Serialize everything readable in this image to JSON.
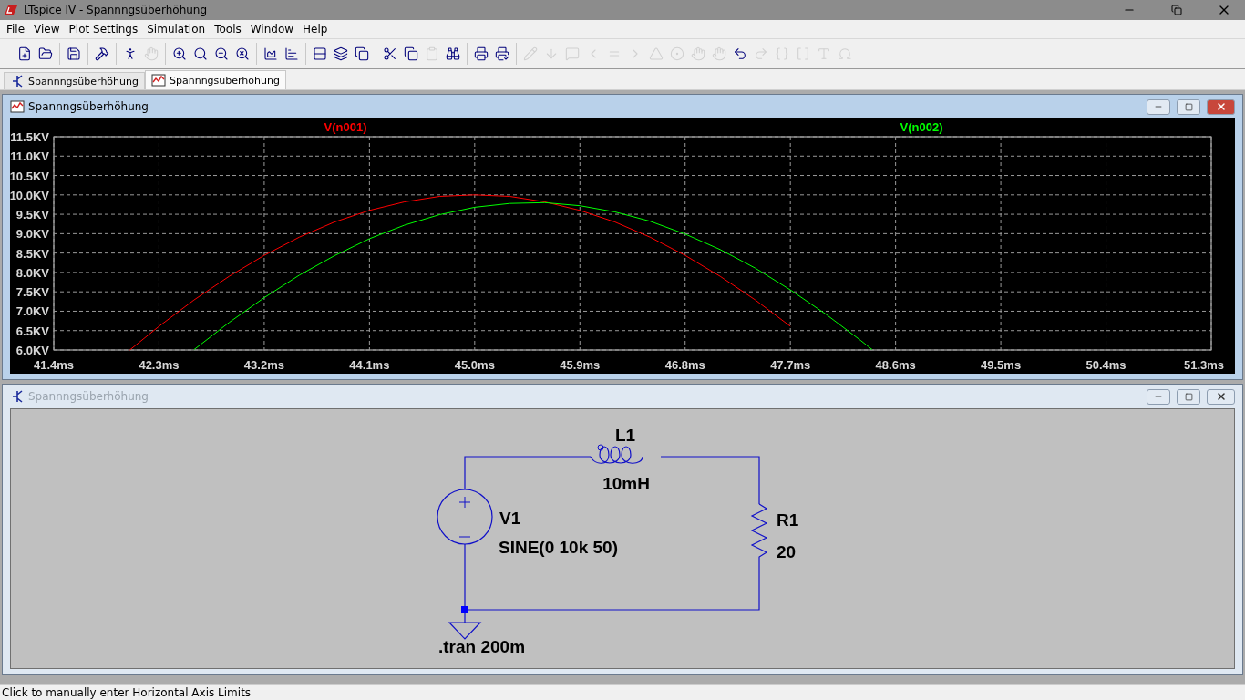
{
  "window": {
    "title": "LTspice IV - Spannngsüberhöhung"
  },
  "menu": [
    "File",
    "View",
    "Plot Settings",
    "Simulation",
    "Tools",
    "Window",
    "Help"
  ],
  "toolbar": [
    {
      "disabled": false
    },
    {
      "disabled": false
    },
    {
      "disabled": false
    },
    {
      "disabled": false
    },
    {
      "disabled": false
    },
    {
      "disabled": true
    },
    {
      "disabled": false
    },
    {
      "disabled": false
    },
    {
      "disabled": false
    },
    {
      "disabled": false
    },
    {
      "disabled": false
    },
    {
      "disabled": false
    },
    {
      "disabled": false
    },
    {
      "disabled": false
    },
    {
      "disabled": false
    },
    {
      "disabled": false
    },
    {
      "disabled": false
    },
    {
      "disabled": true
    },
    {
      "disabled": false
    },
    {
      "disabled": false
    },
    {
      "disabled": false
    },
    {
      "disabled": true
    },
    {
      "disabled": true
    },
    {
      "disabled": true
    },
    {
      "disabled": true
    },
    {
      "disabled": true
    },
    {
      "disabled": true
    },
    {
      "disabled": true
    },
    {
      "disabled": true
    },
    {
      "disabled": true
    },
    {
      "disabled": true
    },
    {
      "disabled": false
    },
    {
      "disabled": true
    },
    {
      "disabled": true
    },
    {
      "disabled": true
    },
    {
      "disabled": true
    },
    {
      "disabled": true
    }
  ],
  "tabs": [
    {
      "label": "Spannngsüberhöhung",
      "kind": "schematic",
      "selected": false
    },
    {
      "label": "Spannngsüberhöhung",
      "kind": "plot",
      "selected": true
    }
  ],
  "plot_window": {
    "title": "Spannngsüberhöhung",
    "active": true,
    "chart_data": {
      "type": "line",
      "x": [
        42.05,
        42.3,
        42.6,
        42.9,
        43.2,
        43.5,
        43.8,
        44.1,
        44.4,
        44.7,
        45.0,
        45.3,
        45.6,
        45.9,
        46.2,
        46.5,
        46.8,
        47.1,
        47.4,
        47.7,
        48.0,
        48.3,
        48.4
      ],
      "series": [
        {
          "name": "V(n001)",
          "color": "#ff0000",
          "values": [
            6.0,
            6.61,
            7.29,
            7.9,
            8.44,
            8.91,
            9.3,
            9.6,
            9.82,
            9.96,
            10.0,
            9.96,
            9.82,
            9.6,
            9.3,
            8.91,
            8.44,
            7.9,
            7.29,
            6.61,
            null,
            null,
            null
          ]
        },
        {
          "name": "V(n002)",
          "color": "#00ff00",
          "values": [
            null,
            null,
            6.01,
            6.71,
            7.35,
            7.93,
            8.43,
            8.87,
            9.22,
            9.49,
            9.68,
            9.78,
            9.8,
            9.72,
            9.56,
            9.32,
            8.99,
            8.59,
            8.11,
            7.55,
            6.93,
            6.25,
            6.01
          ]
        }
      ],
      "grid": true,
      "xlim": [
        41.4,
        51.3
      ],
      "ylim": [
        6.0,
        11.5
      ],
      "xticks": [
        {
          "value": 41.4,
          "label": "41.4ms"
        },
        {
          "value": 42.3,
          "label": "42.3ms"
        },
        {
          "value": 43.2,
          "label": "43.2ms"
        },
        {
          "value": 44.1,
          "label": "44.1ms"
        },
        {
          "value": 45.0,
          "label": "45.0ms"
        },
        {
          "value": 45.9,
          "label": "45.9ms"
        },
        {
          "value": 46.8,
          "label": "46.8ms"
        },
        {
          "value": 47.7,
          "label": "47.7ms"
        },
        {
          "value": 48.6,
          "label": "48.6ms"
        },
        {
          "value": 49.5,
          "label": "49.5ms"
        },
        {
          "value": 50.4,
          "label": "50.4ms"
        },
        {
          "value": 51.3,
          "label": "51.3ms"
        }
      ],
      "yticks": [
        {
          "value": 11.5,
          "label": "11.5KV"
        },
        {
          "value": 11.0,
          "label": "11.0KV"
        },
        {
          "value": 10.5,
          "label": "10.5KV"
        },
        {
          "value": 10.0,
          "label": "10.0KV"
        },
        {
          "value": 9.5,
          "label": "9.5KV"
        },
        {
          "value": 9.0,
          "label": "9.0KV"
        },
        {
          "value": 8.5,
          "label": "8.5KV"
        },
        {
          "value": 8.0,
          "label": "8.0KV"
        },
        {
          "value": 7.5,
          "label": "7.5KV"
        },
        {
          "value": 7.0,
          "label": "7.0KV"
        },
        {
          "value": 6.5,
          "label": "6.5KV"
        },
        {
          "value": 6.0,
          "label": "6.0KV"
        }
      ]
    }
  },
  "schematic_window": {
    "title": "Spannngsüberhöhung",
    "active": false,
    "labels": {
      "inductor_name": "L1",
      "inductor_value": "10mH",
      "source_name": "V1",
      "source_value": "SINE(0 10k 50)",
      "resistor_name": "R1",
      "resistor_value": "20",
      "directive": ".tran 200m"
    }
  },
  "status_bar": "Click to manually enter Horizontal Axis Limits"
}
